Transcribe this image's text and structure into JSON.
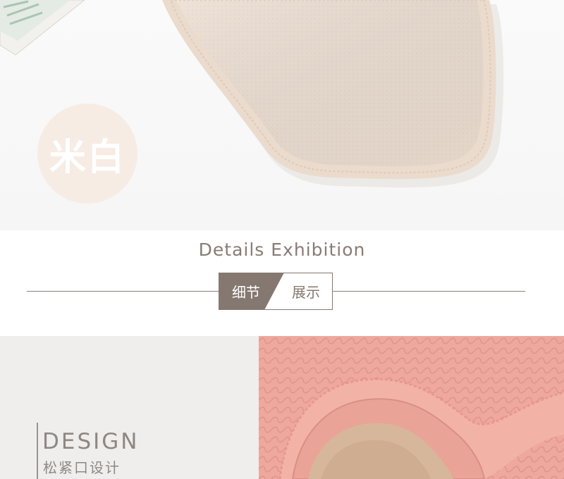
{
  "hero": {
    "color_label": "米白"
  },
  "section": {
    "title": "Details Exhibition",
    "tag_left": "细节",
    "tag_right": "展示"
  },
  "design": {
    "title": "DESIGN",
    "subtitle": "松紧口设计"
  },
  "colors": {
    "accent": "#857870",
    "badge": "#f6ece4",
    "product_cream": "#efe2d6",
    "product_pink": "#eea89e",
    "detail_bg": "#efeeec"
  }
}
